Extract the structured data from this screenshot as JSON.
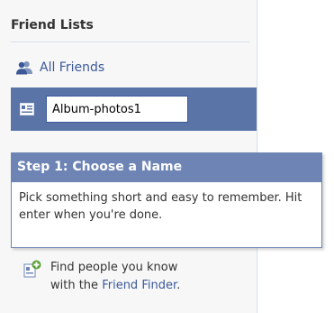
{
  "sidebar": {
    "title": "Friend Lists",
    "all_friends_label": "All Friends",
    "new_list_value": "Album-photos1"
  },
  "tooltip": {
    "header": "Step 1: Choose a Name",
    "body": "Pick something short and easy to remember. Hit enter when you're done."
  },
  "finder": {
    "text_line1": "Find people you know",
    "text_with": "with the",
    "link_label": "Friend Finder",
    "text_end": "."
  },
  "colors": {
    "brand_blue": "#3b5998",
    "highlight_row": "#5b74a8",
    "tooltip_header": "#6d84b4"
  }
}
